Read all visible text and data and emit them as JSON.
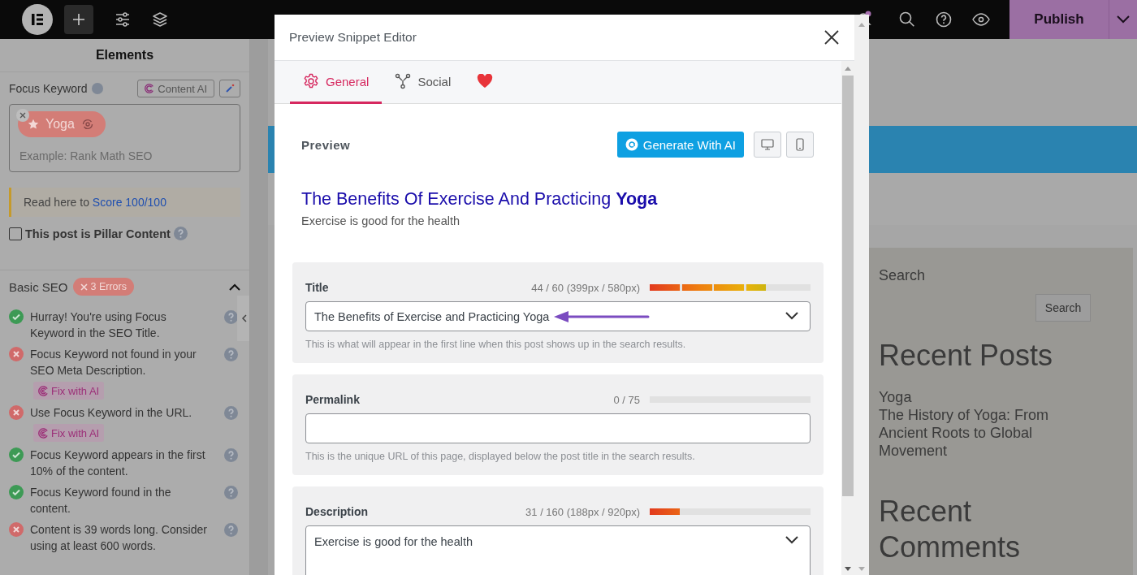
{
  "top_bar": {
    "publish_button": "Publish"
  },
  "editor_panel": {
    "title": "Elements",
    "focus_keyword_label": "Focus Keyword",
    "content_ai_button": "Content AI",
    "keyword": {
      "text": "Yoga",
      "placeholder": "Example: Rank Math SEO"
    },
    "notice": {
      "text": "Read here to ",
      "link": "Score 100/100"
    },
    "pillar": {
      "label": "This post is Pillar Content",
      "checked": false
    },
    "basic_seo": {
      "title": "Basic SEO",
      "errors_badge": "3 Errors",
      "expanded": true,
      "checks": [
        {
          "text": "Hurray! You're using Focus Keyword in the SEO Title.",
          "passed": true
        },
        {
          "text": "Focus Keyword not found in your SEO Meta Description.",
          "passed": false,
          "fix_button": "Fix with AI"
        },
        {
          "text": "Use Focus Keyword in the URL.",
          "passed": false,
          "fix_button": "Fix with AI"
        },
        {
          "text": "Focus Keyword appears in the first 10% of the content.",
          "passed": true
        },
        {
          "text": "Focus Keyword found in the content.",
          "passed": true
        },
        {
          "text": "Content is 39 words long. Consider using at least 600 words.",
          "passed": false
        }
      ]
    }
  },
  "site_page": {
    "search_label": "Search",
    "search_button": "Search",
    "recent_posts_heading": "Recent Posts",
    "posts": [
      "Yoga",
      "The History of Yoga: From Ancient Roots to Global Movement"
    ],
    "recent_comments_heading": "Recent Comments"
  },
  "modal": {
    "title": "Preview Snippet Editor",
    "tabs": [
      {
        "kind": "gear",
        "label": "General",
        "selected": true
      },
      {
        "kind": "social",
        "label": "Social",
        "selected": false
      },
      {
        "kind": "heart",
        "selected": false
      }
    ],
    "preview_label": "Preview",
    "generate_button": "Generate With AI",
    "devices": [
      {
        "kind": "desktop"
      },
      {
        "kind": "mobile"
      }
    ],
    "snippet": {
      "title": "The Benefits Of Exercise And Practicing **Yoga**",
      "description": "Exercise is good for the health"
    },
    "fields": [
      {
        "kind": "select",
        "label": "Title",
        "counter": "44 / 60 (399px / 580px)",
        "level": 0.72,
        "value": "The Benefits of Exercise and Practicing Yoga",
        "hint": "This is what will appear in the first line when this post shows up in the search results."
      },
      {
        "kind": "text",
        "label": "Permalink",
        "counter": "0 / 75",
        "hint": "This is the unique URL of this page, displayed below the post title in the search results."
      },
      {
        "kind": "textarea",
        "label": "Description",
        "counter": "31 / 160 (188px / 920px)",
        "level": 0.19,
        "value": "Exercise is good for the health"
      }
    ]
  }
}
